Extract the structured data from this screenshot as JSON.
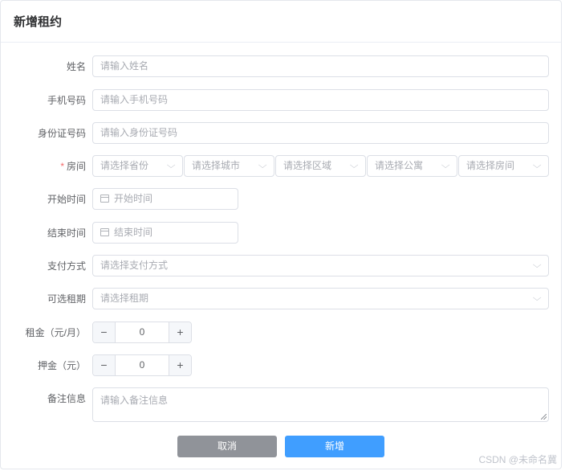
{
  "header": {
    "title": "新增租约"
  },
  "form": {
    "name": {
      "label": "姓名",
      "placeholder": "请输入姓名"
    },
    "phone": {
      "label": "手机号码",
      "placeholder": "请输入手机号码"
    },
    "id_card": {
      "label": "身份证号码",
      "placeholder": "请输入身份证号码"
    },
    "room": {
      "required_mark": "*",
      "label": "房间",
      "selects": [
        "请选择省份",
        "请选择城市",
        "请选择区域",
        "请选择公寓",
        "请选择房间"
      ]
    },
    "start_time": {
      "label": "开始时间",
      "placeholder": "开始时间"
    },
    "end_time": {
      "label": "结束时间",
      "placeholder": "结束时间"
    },
    "payment": {
      "label": "支付方式",
      "placeholder": "请选择支付方式"
    },
    "term": {
      "label": "可选租期",
      "placeholder": "请选择租期"
    },
    "rent": {
      "label": "租金（元/月）",
      "value": "0",
      "minus": "−",
      "plus": "+"
    },
    "deposit": {
      "label": "押金（元）",
      "value": "0",
      "minus": "−",
      "plus": "+"
    },
    "remark": {
      "label": "备注信息",
      "placeholder": "请输入备注信息"
    }
  },
  "actions": {
    "cancel": "取消",
    "submit": "新增"
  },
  "icons": {
    "select_arrow": "chevron-down-icon",
    "date": "calendar-icon"
  },
  "colors": {
    "primary": "#409eff",
    "cancel": "#909399",
    "required": "#f56c6c"
  },
  "watermark": "CSDN @未命名冀"
}
